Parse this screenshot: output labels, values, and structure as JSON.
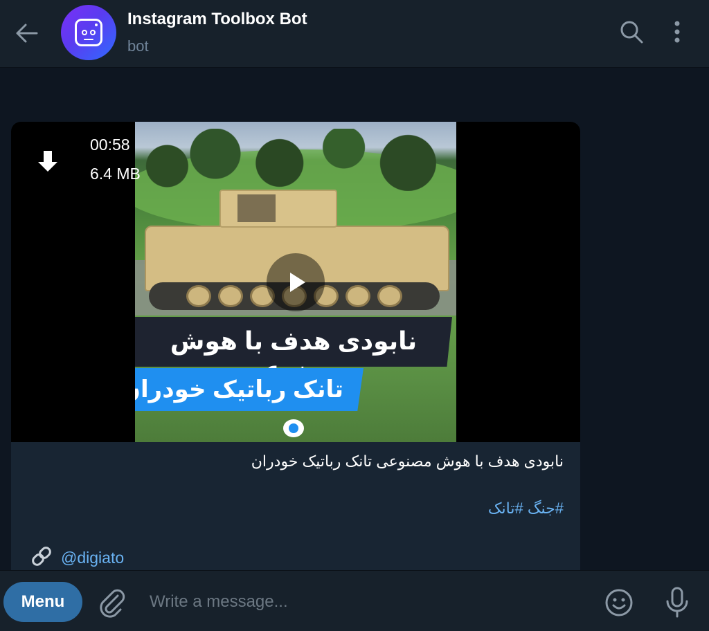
{
  "header": {
    "title": "Instagram Toolbox Bot",
    "subtitle": "bot",
    "back_icon": "arrow-left-icon",
    "search_icon": "search-icon",
    "more_icon": "more-vertical-icon"
  },
  "message": {
    "video": {
      "duration": "00:58",
      "file_size": "6.4 MB",
      "thumbnail_text_line1": "نابودی هدف با هوش مصنوعی",
      "thumbnail_text_line2": "تانک رباتیک خودران",
      "download_icon": "download-arrow-icon",
      "play_icon": "play-icon"
    },
    "caption": "نابودی هدف با هوش مصنوعی تانک رباتیک خودران",
    "hashtags": [
      "#جنگ",
      "#تانک"
    ],
    "link_icon": "link-icon",
    "link_text": "@digiato"
  },
  "compose": {
    "menu_label": "Menu",
    "placeholder": "Write a message...",
    "attach_icon": "paperclip-icon",
    "emoji_icon": "emoji-icon",
    "mic_icon": "microphone-icon"
  },
  "colors": {
    "background": "#0e1621",
    "header_bg": "#17212b",
    "bubble_bg": "#182533",
    "link": "#6ab3f3",
    "menu_button": "#2f6ea5"
  }
}
